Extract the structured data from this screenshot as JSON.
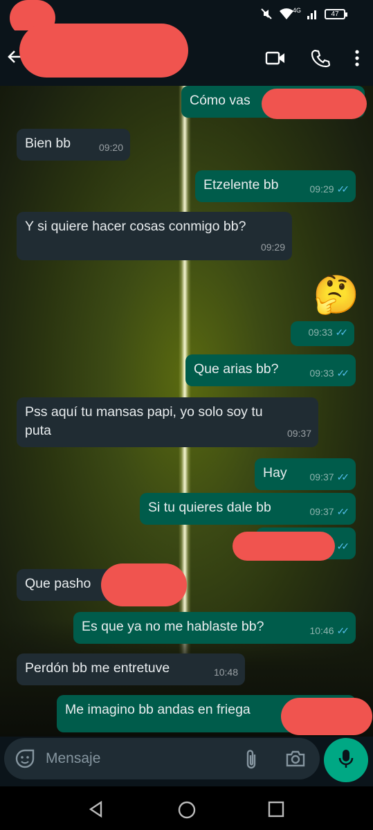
{
  "status": {
    "battery": "47",
    "network": "4G"
  },
  "header": {
    "contact_name": ""
  },
  "messages": [
    {
      "dir": "out",
      "text": "Cómo vas",
      "time": ""
    },
    {
      "dir": "in",
      "text": "Bien bb",
      "time": "09:20"
    },
    {
      "dir": "out",
      "text": "Etzelente bb",
      "time": "09:29"
    },
    {
      "dir": "in",
      "text": "Y si quiere hacer cosas conmigo bb?",
      "time": "09:29"
    },
    {
      "dir": "out",
      "text": "🤔",
      "time": "09:33"
    },
    {
      "dir": "out",
      "text": "Que arias bb?",
      "time": "09:33"
    },
    {
      "dir": "in",
      "text": "Pss aquí tu mansas papi, yo solo soy tu puta",
      "line1": "Pss aquí tu mansas papi, yo solo soy tu",
      "line2": "puta",
      "time": "09:37"
    },
    {
      "dir": "out",
      "text": "Hay",
      "time": "09:37"
    },
    {
      "dir": "out",
      "text": "Si tu quieres dale bb",
      "time": "09:37"
    },
    {
      "dir": "out",
      "text": "",
      "time": ""
    },
    {
      "dir": "in",
      "text": "Que pasho",
      "time": ""
    },
    {
      "dir": "out",
      "text": "Es que ya no me hablaste bb?",
      "time": "10:46"
    },
    {
      "dir": "in",
      "text": "Perdón bb me entretuve",
      "time": "10:48"
    },
    {
      "dir": "out",
      "text": "Me imagino bb andas en friega",
      "time": ""
    }
  ],
  "composer": {
    "placeholder": "Mensaje"
  },
  "colors": {
    "incoming": "#202c33",
    "outgoing": "#005c4b",
    "accent": "#00a884",
    "redaction": "#f0544f"
  },
  "icons": [
    "back-arrow-icon",
    "video-call-icon",
    "voice-call-icon",
    "more-options-icon",
    "sticker-icon",
    "attach-icon",
    "camera-icon",
    "mic-icon",
    "nav-back-icon",
    "nav-home-icon",
    "nav-recents-icon"
  ]
}
